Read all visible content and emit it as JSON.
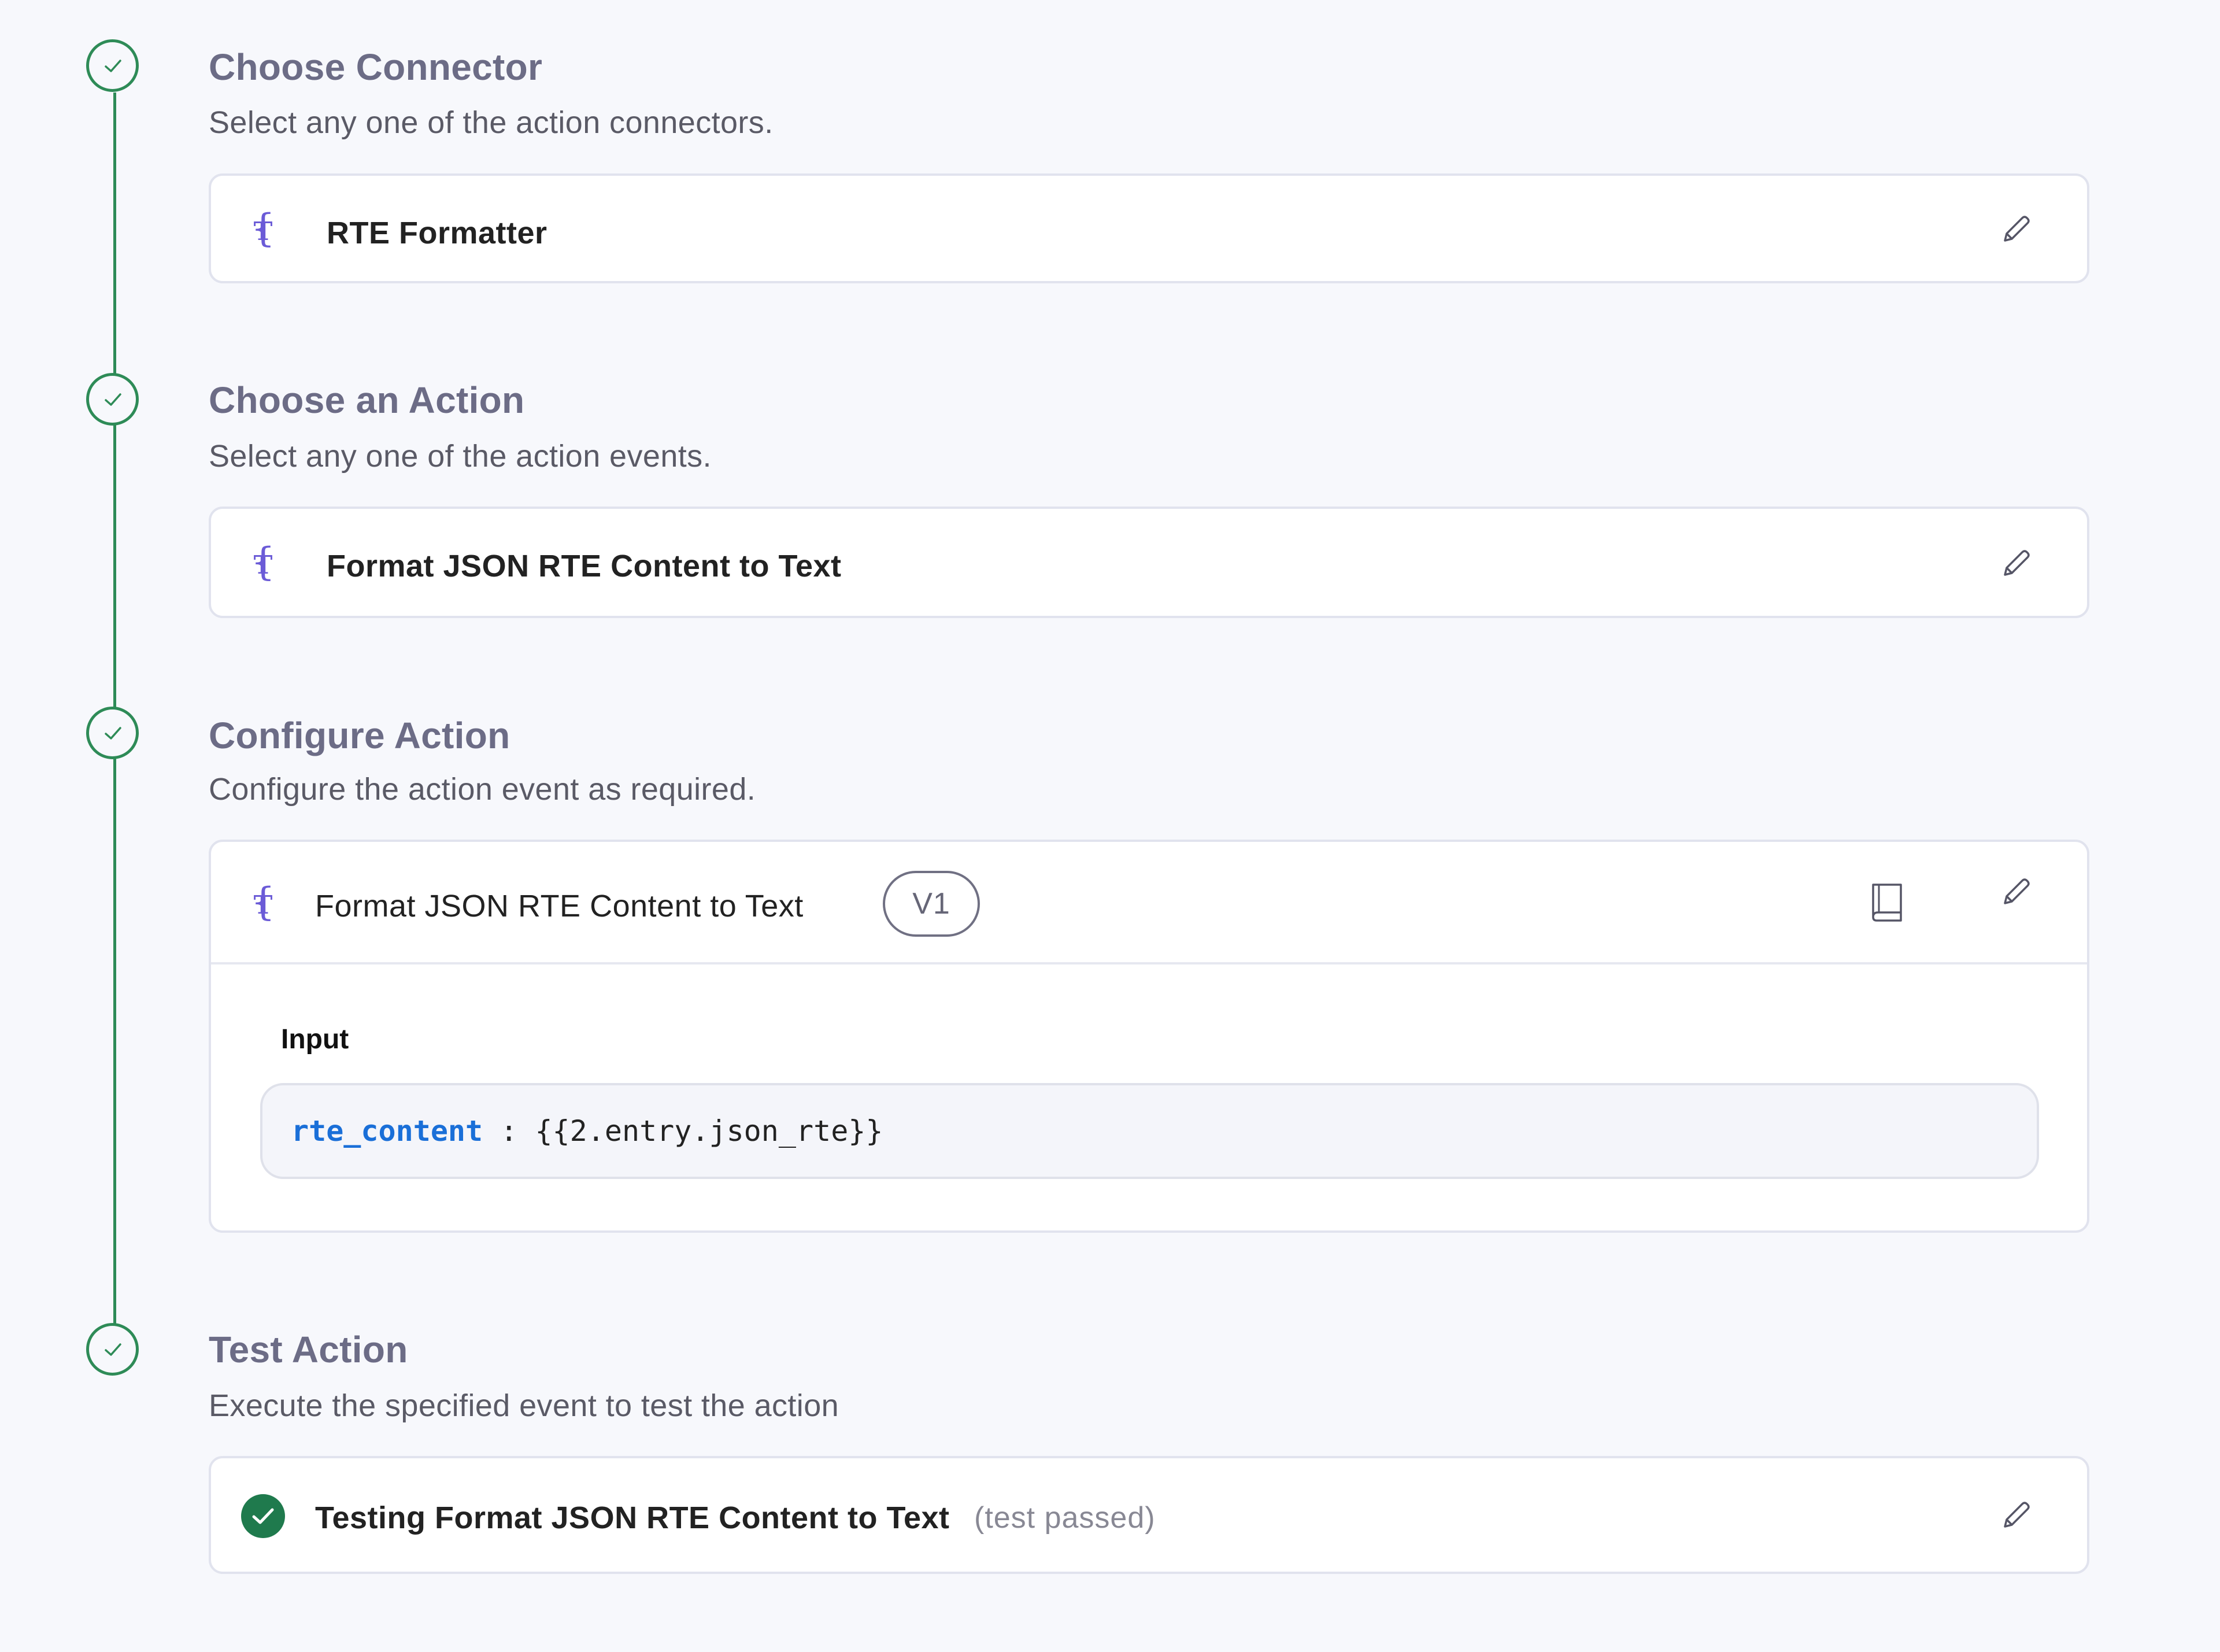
{
  "colors": {
    "accent_green": "#2e8b57",
    "brand_purple": "#6b5bd7",
    "code_key_blue": "#1a6fd8",
    "background": "#f7f8fc"
  },
  "steps": [
    {
      "title": "Choose Connector",
      "subtitle": "Select any one of the action connectors.",
      "status_icon": "check-icon",
      "card": {
        "icon": "rte-formatter-icon",
        "label": "RTE Formatter",
        "edit_icon": "pencil-icon"
      }
    },
    {
      "title": "Choose an Action",
      "subtitle": "Select any one of the action events.",
      "status_icon": "check-icon",
      "card": {
        "icon": "rte-formatter-icon",
        "label": "Format JSON RTE Content to Text",
        "edit_icon": "pencil-icon"
      }
    },
    {
      "title": "Configure Action",
      "subtitle": "Configure the action event as required.",
      "status_icon": "check-icon",
      "card": {
        "icon": "rte-formatter-icon",
        "label": "Format JSON RTE Content to Text",
        "version": "V1",
        "docs_icon": "book-icon",
        "edit_icon": "pencil-icon",
        "input_label": "Input",
        "input": {
          "key": "rte_content",
          "separator": " : ",
          "value": "{{2.entry.json_rte}}"
        }
      }
    },
    {
      "title": "Test Action",
      "subtitle": "Execute the specified event to test the action",
      "status_icon": "check-icon",
      "card": {
        "icon": "check-circle-filled-icon",
        "label": "Testing Format JSON RTE Content to Text",
        "note": "(test passed)",
        "edit_icon": "pencil-icon"
      }
    }
  ]
}
